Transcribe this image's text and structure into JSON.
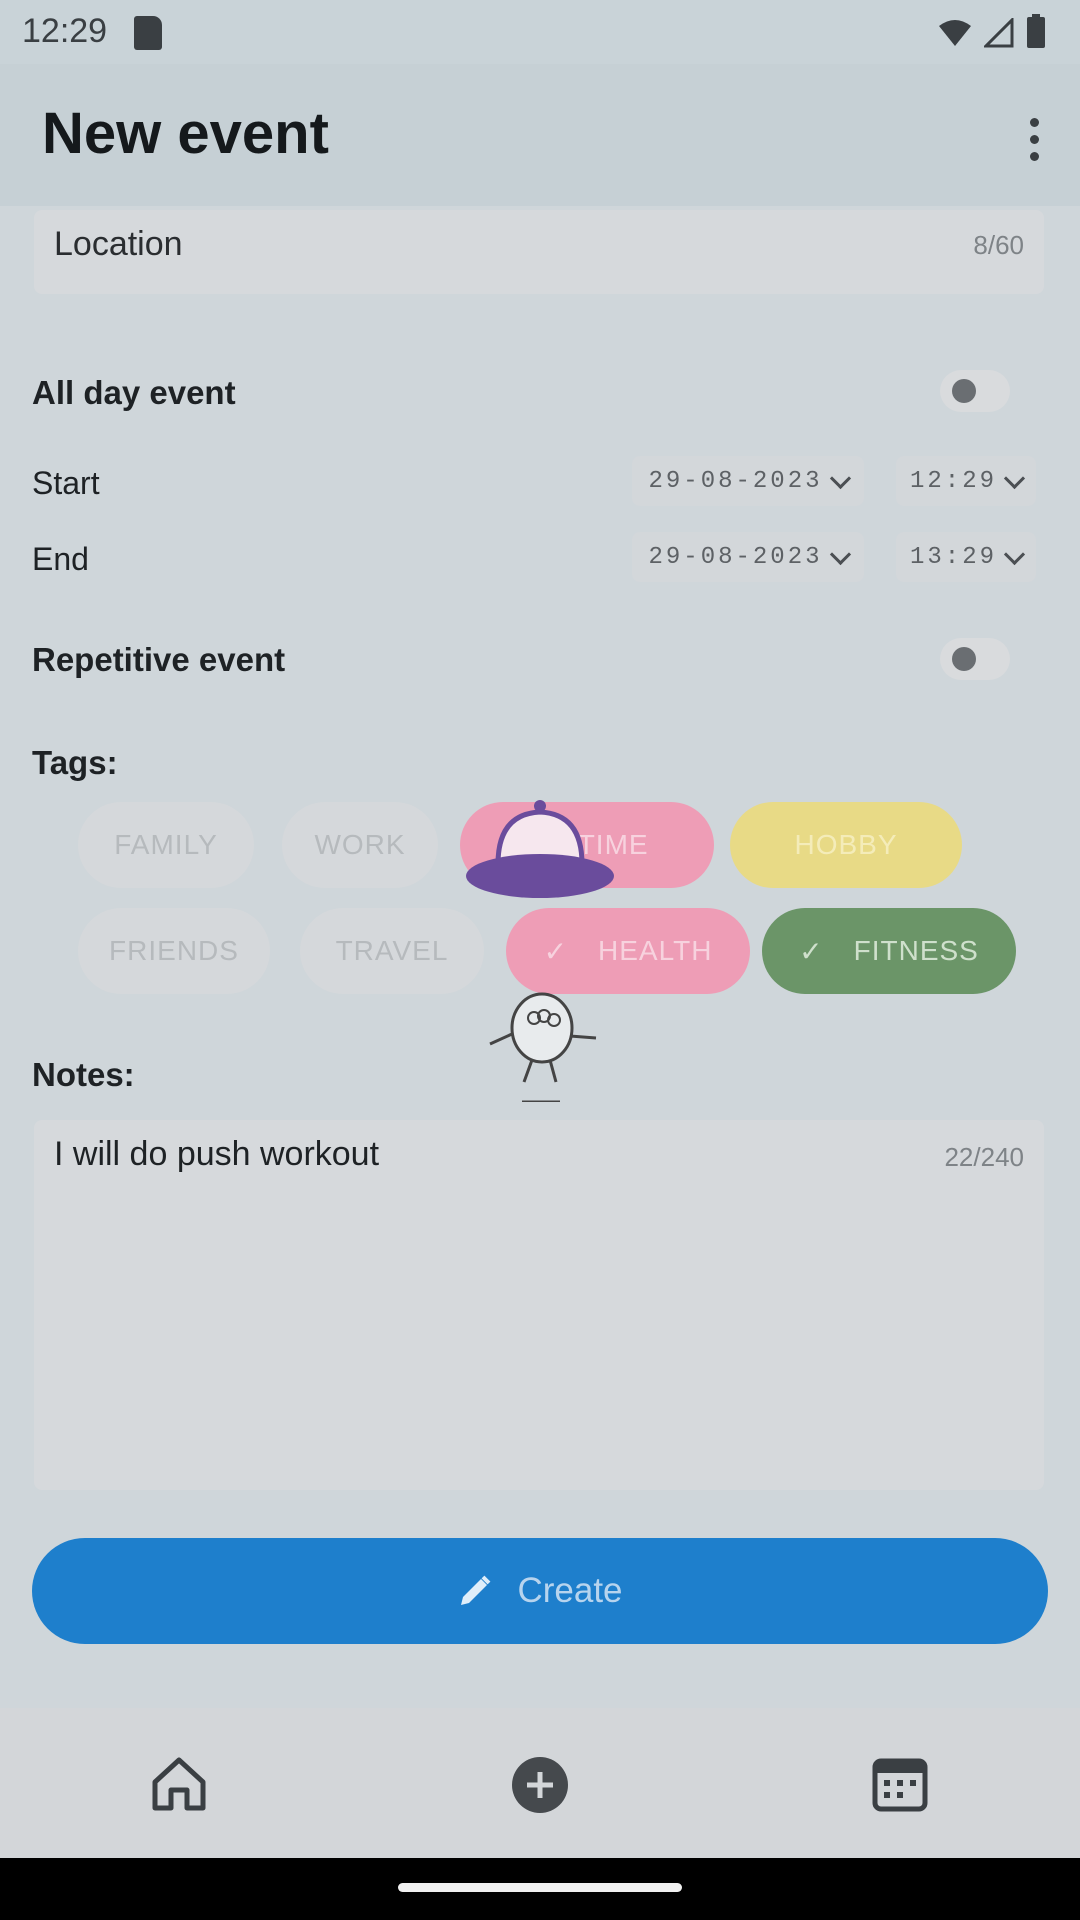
{
  "status": {
    "time": "12:29"
  },
  "header": {
    "title": "New event"
  },
  "location": {
    "label": "Location",
    "counter": "8/60"
  },
  "all_day": {
    "label": "All day event"
  },
  "start": {
    "label": "Start",
    "date": "29-08-2023",
    "time": "12:29"
  },
  "end": {
    "label": "End",
    "date": "29-08-2023",
    "time": "13:29"
  },
  "repetitive": {
    "label": "Repetitive event"
  },
  "tags": {
    "label": "Tags:",
    "items": [
      "FAMILY",
      "WORK",
      "ME TIME",
      "HOBBY",
      "FRIENDS",
      "TRAVEL",
      "HEALTH",
      "FITNESS"
    ],
    "colors": {
      "pink": "#ee9db6",
      "yellow": "#e8da86",
      "green": "#6b9568"
    }
  },
  "notes": {
    "label": "Notes:",
    "value": "I will do push workout",
    "counter": "22/240"
  },
  "create_button": {
    "label": "Create",
    "color": "#1e7fcc"
  },
  "bottom_nav": {
    "items": [
      "home-icon",
      "add-icon",
      "calendar-icon"
    ]
  }
}
